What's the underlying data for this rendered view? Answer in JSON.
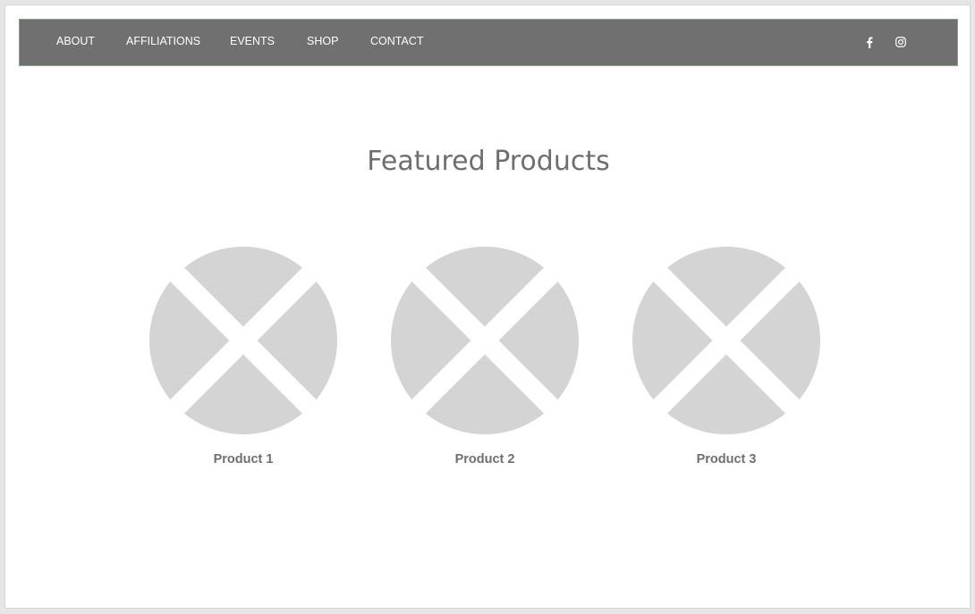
{
  "nav": {
    "items": [
      "ABOUT",
      "AFFILIATIONS",
      "EVENTS",
      "SHOP",
      "CONTACT"
    ],
    "social_icons": [
      "facebook-icon",
      "instagram-icon"
    ]
  },
  "main": {
    "heading": "Featured Products",
    "products": [
      {
        "name": "Product 1",
        "image_icon": "image-placeholder-icon"
      },
      {
        "name": "Product 2",
        "image_icon": "image-placeholder-icon"
      },
      {
        "name": "Product 3",
        "image_icon": "image-placeholder-icon"
      }
    ]
  },
  "colors": {
    "nav_background": "#707070",
    "nav_text": "#ffffff",
    "heading_text": "#6e6e6e",
    "placeholder": "#d4d4d4",
    "product_text": "#6f6f6f"
  }
}
